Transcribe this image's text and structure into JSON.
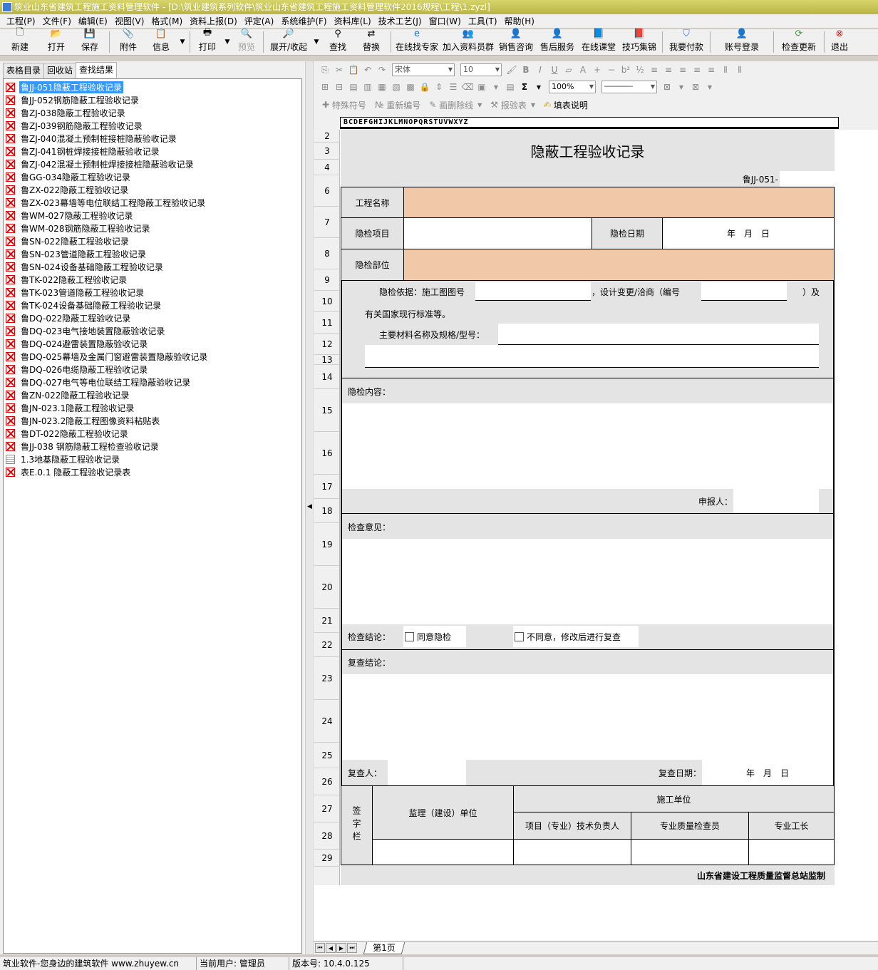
{
  "window": {
    "title": "筑业山东省建筑工程施工资料管理软件 - [D:\\筑业建筑系列软件\\筑业山东省建筑工程施工资料管理软件2016规程\\工程\\1.zyzl]"
  },
  "menu": [
    "工程(P)",
    "文件(F)",
    "编辑(E)",
    "视图(V)",
    "格式(M)",
    "资料上报(D)",
    "评定(A)",
    "系统维护(F)",
    "资料库(L)",
    "技术工艺(J)",
    "窗口(W)",
    "工具(T)",
    "帮助(H)"
  ],
  "toolbar": {
    "new": "新建",
    "open": "打开",
    "save": "保存",
    "attach": "附件",
    "info": "信息",
    "print": "打印",
    "preview": "预览",
    "expand": "展开/收起",
    "find": "查找",
    "replace": "替换",
    "online_expert": "在线找专家",
    "join_group": "加入资料员群",
    "sales": "销售咨询",
    "after_sales": "售后服务",
    "online_class": "在线课堂",
    "tips": "技巧集锦",
    "pay": "我要付款",
    "login": "账号登录",
    "update": "检查更新",
    "exit": "退出"
  },
  "format": {
    "font": "宋体",
    "size": "10",
    "sum": "Σ",
    "zoom": "100%"
  },
  "edit_bar": {
    "special": "特殊符号",
    "renumber": "重新编号",
    "draw_line": "画删除线",
    "report": "报验表",
    "fill_help": "填表说明"
  },
  "left_tabs": [
    "表格目录",
    "回收站",
    "查找结果"
  ],
  "tree": [
    "鲁JJ-051隐蔽工程验收记录",
    "鲁JJ-052钢筋隐蔽工程验收记录",
    "鲁ZJ-038隐蔽工程验收记录",
    "鲁ZJ-039钢筋隐蔽工程验收记录",
    "鲁ZJ-040混凝土预制桩接桩隐蔽验收记录",
    "鲁ZJ-041钢桩焊接接桩隐蔽验收记录",
    "鲁ZJ-042混凝土预制桩焊接接桩隐蔽验收记录",
    "鲁GG-034隐蔽工程验收记录",
    "鲁ZX-022隐蔽工程验收记录",
    "鲁ZX-023幕墙等电位联结工程隐蔽工程验收记录",
    "鲁WM-027隐蔽工程验收记录",
    "鲁WM-028钢筋隐蔽工程验收记录",
    "鲁SN-022隐蔽工程验收记录",
    "鲁SN-023管道隐蔽工程验收记录",
    "鲁SN-024设备基础隐蔽工程验收记录",
    "鲁TK-022隐蔽工程验收记录",
    "鲁TK-023管道隐蔽工程验收记录",
    "鲁TK-024设备基础隐蔽工程验收记录",
    "鲁DQ-022隐蔽工程验收记录",
    "鲁DQ-023电气接地装置隐蔽验收记录",
    "鲁DQ-024避雷装置隐蔽验收记录",
    "鲁DQ-025幕墙及金属门窗避雷装置隐蔽验收记录",
    "鲁DQ-026电缆隐蔽工程验收记录",
    "鲁DQ-027电气等电位联结工程隐蔽验收记录",
    "鲁ZN-022隐蔽工程验收记录",
    "鲁JN-023.1隐蔽工程验收记录",
    "鲁JN-023.2隐蔽工程图像资料粘贴表",
    "鲁DT-022隐蔽工程验收记录",
    "鲁JJ-038 钢筋隐蔽工程检查验收记录",
    "1.3地基隐蔽工程验收记录",
    "表E.0.1 隐蔽工程验收记录表"
  ],
  "col_letters": "BCDEFGHIJKLMNOPQRSTUVWXYZ",
  "rows": [
    "2",
    "3",
    "4",
    "6",
    "7",
    "8",
    "9",
    "10",
    "11",
    "12",
    "13",
    "14",
    "15",
    "16",
    "17",
    "18",
    "19",
    "20",
    "21",
    "22",
    "23",
    "24",
    "25",
    "26",
    "27",
    "28",
    "29"
  ],
  "form": {
    "title": "隐蔽工程验收记录",
    "code": "鲁JJ-051-",
    "project_name": "工程名称",
    "inspect_item": "隐检项目",
    "inspect_date": "隐检日期",
    "ymd": "年　月　日",
    "inspect_part": "隐检部位",
    "basis": "隐检依据：施工图图号",
    "change": "，设计变更/洽商（编号",
    "and": "）及",
    "standards": "有关国家现行标准等。",
    "materials": "主要材料名称及规格/型号：",
    "content": "隐检内容：",
    "reporter": "申报人：",
    "opinion": "检查意见：",
    "conclusion": "检查结论：",
    "agree": "同意隐检",
    "disagree": "不同意，修改后进行复查",
    "recheck": "复查结论：",
    "rechecker": "复查人：",
    "recheck_date": "复查日期：",
    "sign": "签字栏",
    "supervisor": "监理（建设）单位",
    "contractor": "施工单位",
    "tech_lead": "项目（专业）技术负责人",
    "qc": "专业质量检查员",
    "foreman": "专业工长",
    "footer": "山东省建设工程质量监督总站监制"
  },
  "sheet_tab": "第1页",
  "status": {
    "slogan": "筑业软件-您身边的建筑软件 www.zhuyew.cn",
    "user": "当前用户: 管理员",
    "version": "版本号: 10.4.0.125"
  }
}
